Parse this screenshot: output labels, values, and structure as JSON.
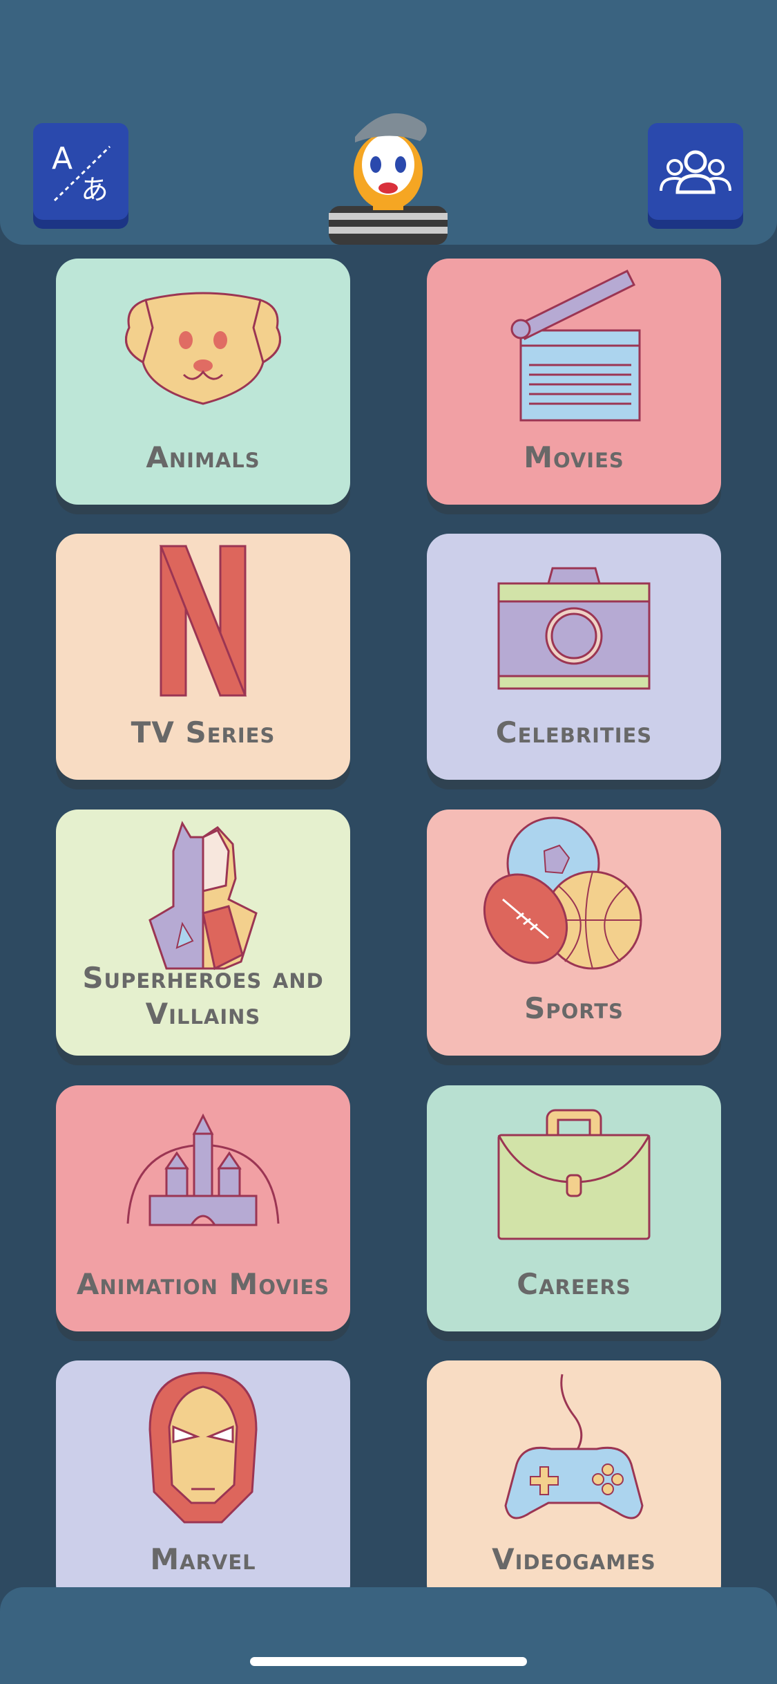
{
  "header": {
    "language_button_icon": "translate-icon",
    "players_button_icon": "group-icon",
    "mascot": "mime-avatar"
  },
  "colors": {
    "background": "#2e4a61",
    "header": "#3a6380",
    "button": "#2a49ad",
    "label": "#686868"
  },
  "categories": [
    {
      "label": "Animals",
      "icon": "dog-icon",
      "bg": "#bde6d7"
    },
    {
      "label": "Movies",
      "icon": "clapperboard-icon",
      "bg": "#f1a0a4"
    },
    {
      "label": "TV Series",
      "icon": "netflix-n-icon",
      "bg": "#f8dcc3"
    },
    {
      "label": "Celebrities",
      "icon": "camera-icon",
      "bg": "#cccfea"
    },
    {
      "label": "Superheroes and Villains",
      "icon": "hero-villain-icon",
      "bg": "#e5f0ce"
    },
    {
      "label": "Sports",
      "icon": "sports-balls-icon",
      "bg": "#f5bcb6"
    },
    {
      "label": "Animation Movies",
      "icon": "castle-icon",
      "bg": "#f1a0a4"
    },
    {
      "label": "Careers",
      "icon": "briefcase-icon",
      "bg": "#b8e0d1"
    },
    {
      "label": "Marvel",
      "icon": "iron-helmet-icon",
      "bg": "#cccfea"
    },
    {
      "label": "Videogames",
      "icon": "gamepad-icon",
      "bg": "#f8dcc3"
    }
  ]
}
